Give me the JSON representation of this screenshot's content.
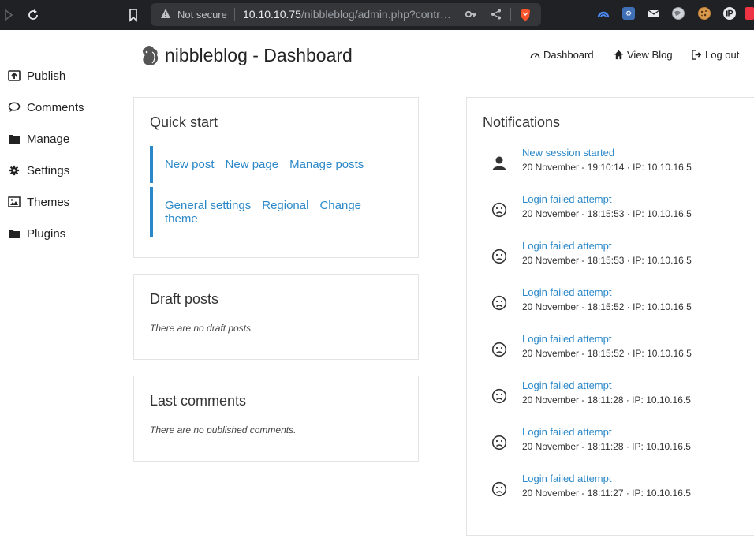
{
  "browser": {
    "security_label": "Not secure",
    "url_host": "10.10.10.75",
    "url_path": "/nibbleblog/admin.php?contr…"
  },
  "sidebar": {
    "items": [
      {
        "label": "Publish",
        "icon": "publish-icon"
      },
      {
        "label": "Comments",
        "icon": "comment-icon"
      },
      {
        "label": "Manage",
        "icon": "folder-icon"
      },
      {
        "label": "Settings",
        "icon": "gear-icon"
      },
      {
        "label": "Themes",
        "icon": "image-icon"
      },
      {
        "label": "Plugins",
        "icon": "folder-icon"
      }
    ]
  },
  "header": {
    "title": "nibbleblog - Dashboard",
    "links": [
      {
        "label": "Dashboard",
        "icon": "dashboard-icon"
      },
      {
        "label": "View Blog",
        "icon": "home-icon"
      },
      {
        "label": "Log out",
        "icon": "logout-icon"
      }
    ]
  },
  "quick_start": {
    "title": "Quick start",
    "group1": [
      "New post",
      "New page",
      "Manage posts"
    ],
    "group2": [
      "General settings",
      "Regional",
      "Change theme"
    ]
  },
  "draft_posts": {
    "title": "Draft posts",
    "empty": "There are no draft posts."
  },
  "last_comments": {
    "title": "Last comments",
    "empty": "There are no published comments."
  },
  "notifications": {
    "title": "Notifications",
    "items": [
      {
        "title": "New session started",
        "meta": "20 November - 19:10:14 · IP: 10.10.16.5",
        "icon": "user-icon"
      },
      {
        "title": "Login failed attempt",
        "meta": "20 November - 18:15:53 · IP: 10.10.16.5",
        "icon": "frown-icon"
      },
      {
        "title": "Login failed attempt",
        "meta": "20 November - 18:15:53 · IP: 10.10.16.5",
        "icon": "frown-icon"
      },
      {
        "title": "Login failed attempt",
        "meta": "20 November - 18:15:52 · IP: 10.10.16.5",
        "icon": "frown-icon"
      },
      {
        "title": "Login failed attempt",
        "meta": "20 November - 18:15:52 · IP: 10.10.16.5",
        "icon": "frown-icon"
      },
      {
        "title": "Login failed attempt",
        "meta": "20 November - 18:11:28 · IP: 10.10.16.5",
        "icon": "frown-icon"
      },
      {
        "title": "Login failed attempt",
        "meta": "20 November - 18:11:28 · IP: 10.10.16.5",
        "icon": "frown-icon"
      },
      {
        "title": "Login failed attempt",
        "meta": "20 November - 18:11:27 · IP: 10.10.16.5",
        "icon": "frown-icon"
      }
    ]
  },
  "colors": {
    "accent": "#2b88c8",
    "chrome_bg": "#202124"
  }
}
